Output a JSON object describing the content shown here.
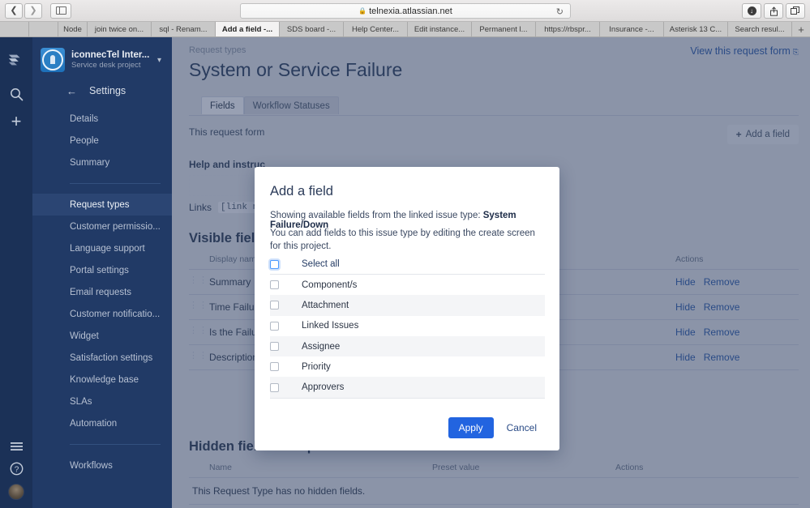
{
  "browser": {
    "back_icon": "chevron-left-icon",
    "forward_icon": "chevron-right-icon",
    "sidebar_icon": "sidebar-toggle-icon",
    "lock_icon": "lock-icon",
    "url": "telnexia.atlassian.net",
    "reload_glyph": "↻",
    "download_icon": "download-icon",
    "share_icon": "share-icon",
    "tabs_icon": "tab-overview-icon",
    "new_tab_glyph": "+",
    "tabs": [
      {
        "label": "",
        "active": false,
        "narrow": true
      },
      {
        "label": "",
        "active": false,
        "narrow": true
      },
      {
        "label": "Node",
        "active": false,
        "narrow": true
      },
      {
        "label": "join twice on...",
        "active": false
      },
      {
        "label": "sql - Renam...",
        "active": false
      },
      {
        "label": "Add a field -...",
        "active": true
      },
      {
        "label": "SDS board -...",
        "active": false
      },
      {
        "label": "Help Center...",
        "active": false
      },
      {
        "label": "Edit instance...",
        "active": false
      },
      {
        "label": "Permanent l...",
        "active": false
      },
      {
        "label": "https://rbspr...",
        "active": false
      },
      {
        "label": "Insurance -...",
        "active": false
      },
      {
        "label": "Asterisk 13 C...",
        "active": false
      },
      {
        "label": "Search resul...",
        "active": false
      }
    ]
  },
  "rail": {
    "logo_icon": "jira-logo-icon",
    "search_icon": "search-icon",
    "create_icon": "plus-icon",
    "menu_icon": "hamburger-menu-icon",
    "help_icon": "help-circle-icon",
    "avatar_icon": "user-avatar"
  },
  "sidebar": {
    "project_name": "iconnecTel Inter...",
    "project_subtitle": "Service desk project",
    "project_avatar_icon": "project-avatar-icon",
    "chevron_icon": "chevron-down-icon",
    "back_icon": "arrow-left-icon",
    "settings_title": "Settings",
    "group1": [
      {
        "label": "Details",
        "selected": false
      },
      {
        "label": "People",
        "selected": false
      },
      {
        "label": "Summary",
        "selected": false
      }
    ],
    "group2": [
      {
        "label": "Request types",
        "selected": true
      },
      {
        "label": "Customer permissio...",
        "selected": false
      },
      {
        "label": "Language support",
        "selected": false
      },
      {
        "label": "Portal settings",
        "selected": false
      },
      {
        "label": "Email requests",
        "selected": false
      },
      {
        "label": "Customer notificatio...",
        "selected": false
      },
      {
        "label": "Widget",
        "selected": false
      },
      {
        "label": "Satisfaction settings",
        "selected": false
      },
      {
        "label": "Knowledge base",
        "selected": false
      },
      {
        "label": "SLAs",
        "selected": false
      },
      {
        "label": "Automation",
        "selected": false
      }
    ],
    "group3": [
      {
        "label": "Workflows",
        "selected": false
      }
    ]
  },
  "content": {
    "breadcrumb": "Request types",
    "page_title": "System or Service Failure",
    "view_link": "View this request form",
    "view_link_icon": "external-link-icon",
    "tabs": [
      {
        "label": "Fields",
        "active": true
      },
      {
        "label": "Workflow Statuses",
        "active": false
      }
    ],
    "request_form_text": "This request form",
    "add_field_button": "Add a field",
    "add_field_icon": "plus-icon",
    "help_label": "Help and instruc",
    "links_label": "Links",
    "links_code": "[link nam",
    "visible_section_title": "Visible fields",
    "visible_table": {
      "headers": {
        "name": "Display name",
        "actions": "Actions"
      },
      "grip_icon": "drag-handle-icon",
      "rows": [
        {
          "name": "Summary",
          "hide": "Hide",
          "remove": "Remove"
        },
        {
          "name": "Time Failure …",
          "hide": "Hide",
          "remove": "Remove"
        },
        {
          "name": "Is the Failure",
          "hide": "Hide",
          "remove": "Remove"
        },
        {
          "name": "Description o… be reproduce",
          "hide": "Hide",
          "remove": "Remove"
        }
      ]
    },
    "hidden_section_title": "Hidden fields with preset values",
    "hidden_table": {
      "headers": {
        "name": "Name",
        "preset": "Preset value",
        "actions": "Actions"
      },
      "empty_message": "This Request Type has no hidden fields."
    }
  },
  "modal": {
    "title": "Add a field",
    "desc_prefix": "Showing available fields from the linked issue type: ",
    "desc_issue_type": "System Failure/Down",
    "desc_secondary": "You can add fields to this issue type by editing the create screen for this project.",
    "select_all_label": "Select all",
    "select_all_checked": false,
    "checkbox_icon": "checkbox-icon",
    "fields": [
      {
        "label": "Component/s",
        "checked": false
      },
      {
        "label": "Attachment",
        "checked": false
      },
      {
        "label": "Linked Issues",
        "checked": false
      },
      {
        "label": "Assignee",
        "checked": false
      },
      {
        "label": "Priority",
        "checked": false
      },
      {
        "label": "Approvers",
        "checked": false
      }
    ],
    "apply_label": "Apply",
    "cancel_label": "Cancel"
  },
  "colors": {
    "primary_button": "#2264e0",
    "link": "#2a4b86",
    "sidebar_bg": "#213a66",
    "rail_bg": "#1b3157",
    "backdrop": "#8b94a8"
  }
}
